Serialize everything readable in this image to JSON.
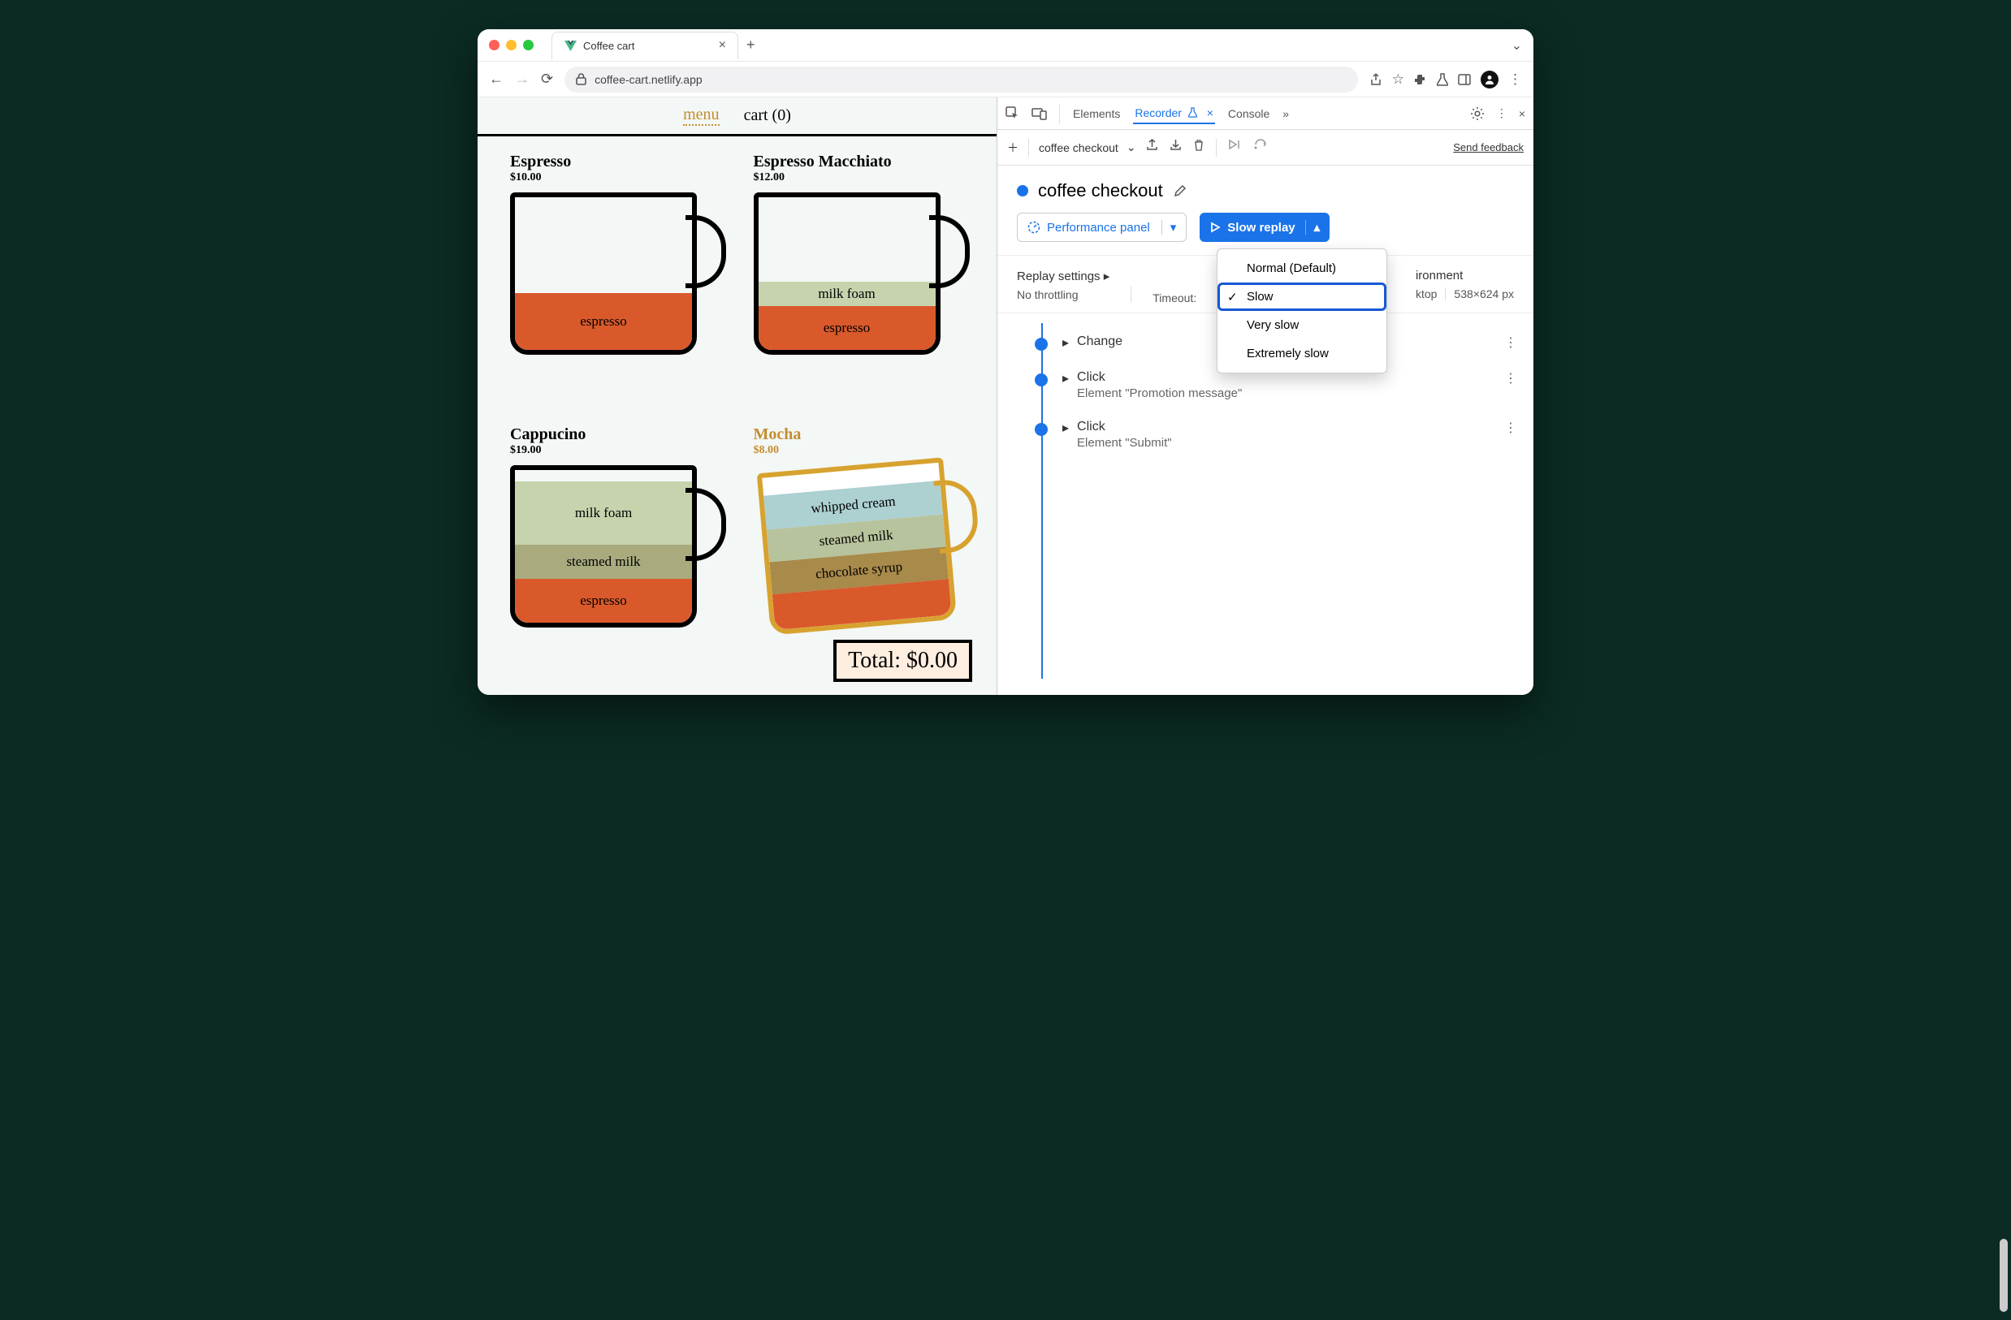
{
  "browser": {
    "tab_title": "Coffee cart",
    "url": "coffee-cart.netlify.app"
  },
  "app": {
    "nav": {
      "menu": "menu",
      "cart": "cart (0)"
    },
    "items": [
      {
        "name": "Espresso",
        "price": "$10.00",
        "layers": [
          [
            "espresso",
            "espresso",
            70
          ]
        ]
      },
      {
        "name": "Espresso Macchiato",
        "price": "$12.00",
        "layers": [
          [
            "milk foam",
            "milkfoam",
            30
          ],
          [
            "espresso",
            "espresso",
            54
          ]
        ]
      },
      {
        "name": "Cappucino",
        "price": "$19.00",
        "layers": [
          [
            "milk foam",
            "milkfoam",
            78
          ],
          [
            "steamed milk",
            "steamed",
            42
          ],
          [
            "espresso",
            "espresso",
            54
          ]
        ]
      },
      {
        "name": "Mocha",
        "price": "$8.00",
        "mocha": true,
        "layers": [
          [
            "whipped cream",
            "whipped",
            42
          ],
          [
            "steamed milk",
            "steamed2",
            40
          ],
          [
            "chocolate syrup",
            "choco",
            40
          ],
          [
            "",
            "espresso",
            44
          ]
        ]
      }
    ],
    "total": "Total: $0.00"
  },
  "devtools": {
    "tabs": {
      "elements": "Elements",
      "recorder": "Recorder",
      "console": "Console"
    },
    "recorder_name": "coffee checkout",
    "title": "coffee checkout",
    "feedback": "Send feedback",
    "perf_btn": "Performance panel",
    "replay_btn": "Slow replay",
    "speed_menu": {
      "normal": "Normal (Default)",
      "slow": "Slow",
      "very": "Very slow",
      "extreme": "Extremely slow"
    },
    "settings": {
      "replay": "Replay settings",
      "throttle": "No throttling",
      "timeout": "Timeout:",
      "env": "ironment",
      "env_desktop": "ktop",
      "dim": "538×624 px"
    },
    "steps": [
      {
        "t": "Change",
        "d": ""
      },
      {
        "t": "Click",
        "d": "Element \"Promotion message\""
      },
      {
        "t": "Click",
        "d": "Element \"Submit\""
      }
    ]
  }
}
